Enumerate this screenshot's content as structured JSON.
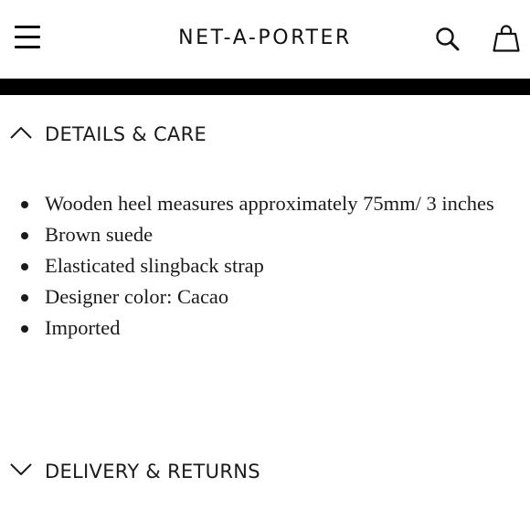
{
  "header": {
    "brand": "NET-A-PORTER",
    "icons": {
      "menu": "hamburger-menu-icon",
      "search": "search-icon",
      "bag": "shopping-bag-icon"
    }
  },
  "details": {
    "title": "DETAILS & CARE",
    "expanded": true,
    "items": [
      "Wooden heel measures approximately 75mm/ 3 inches",
      "Brown suede",
      "Elasticated slingback strap",
      "Designer color: Cacao",
      "Imported"
    ]
  },
  "delivery": {
    "title": "DELIVERY & RETURNS",
    "expanded": false
  },
  "colors": {
    "text": "#1a1a1a",
    "bar": "#000000",
    "background": "#ffffff"
  }
}
